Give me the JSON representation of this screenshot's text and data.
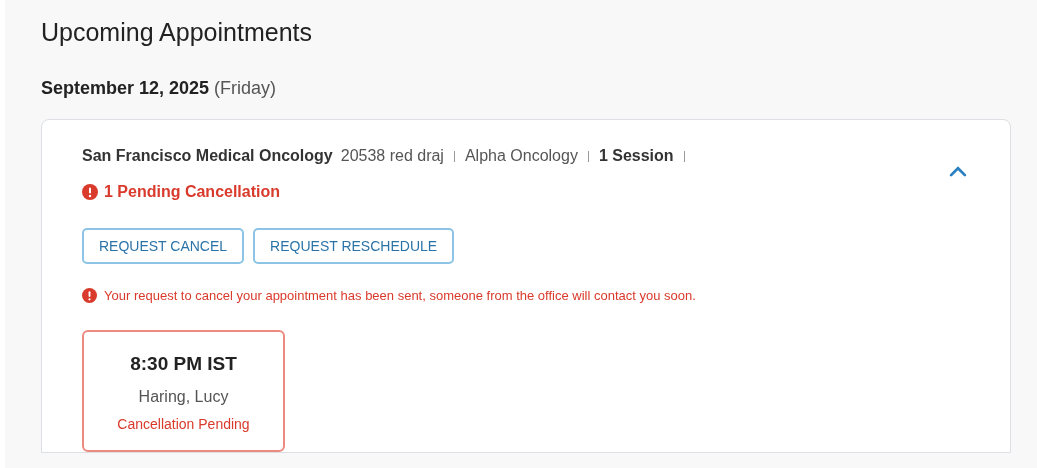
{
  "title": "Upcoming Appointments",
  "date": {
    "date": "September 12, 2025",
    "weekday": "(Friday)"
  },
  "appointment": {
    "location": "San Francisco Medical Oncology",
    "meta": [
      {
        "text": "20538 red draj",
        "bold": false
      },
      {
        "text": "Alpha Oncology",
        "bold": false
      },
      {
        "text": "1 Session",
        "bold": true
      }
    ],
    "expanded": true,
    "alert": "1 Pending Cancellation",
    "buttons": [
      "REQUEST CANCEL",
      "REQUEST RESCHEDULE"
    ],
    "notice": "Your request to cancel your appointment has been sent, someone from the office will contact you soon.",
    "slots": [
      {
        "time": "8:30 PM IST",
        "provider": "Haring, Lucy",
        "status": "Cancellation Pending",
        "kind": "pending"
      }
    ]
  }
}
